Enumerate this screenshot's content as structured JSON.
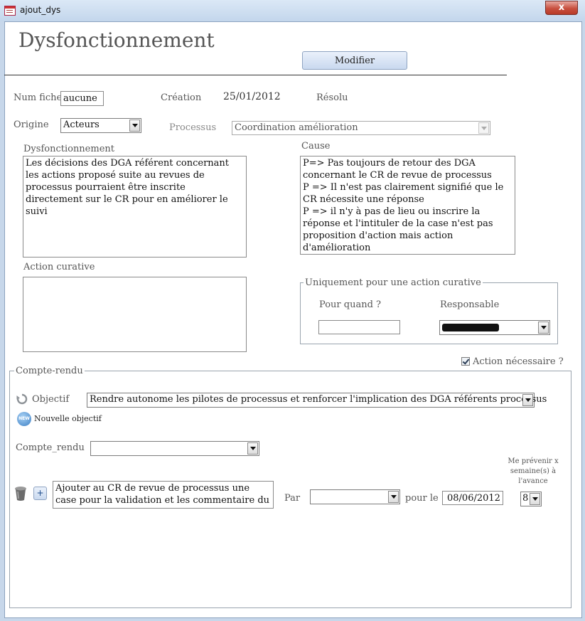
{
  "window": {
    "title": "ajout_dys",
    "close_label": "x"
  },
  "header": {
    "title": "Dysfonctionnement",
    "modify_button": "Modifier"
  },
  "fields": {
    "num_fiche": {
      "label": "Num fiche",
      "value": "aucune"
    },
    "creation": {
      "label": "Création",
      "value": "25/01/2012"
    },
    "resolu": {
      "label": "Résolu"
    },
    "origine": {
      "label": "Origine",
      "value": "Acteurs"
    },
    "processus": {
      "label": "Processus",
      "value": "Coordination amélioration"
    },
    "dysfonctionnement": {
      "label": "Dysfonctionnement",
      "value": "Les décisions des DGA référent concernant les actions proposé suite au revues de processus pourraient être inscrite directement sur le CR pour en améliorer le suivi"
    },
    "cause": {
      "label": "Cause",
      "value": "P=> Pas toujours de retour des DGA concernant le CR de revue de processus\nP => Il n'est pas clairement signifié que le CR nécessite une réponse\nP => il n'y à pas de lieu ou inscrire la réponse et l'intituler de la case n'est pas proposition d'action mais action d'amélioration\nP => Lors de la création des CR processus cela"
    },
    "action_curative": {
      "label": "Action curative",
      "value": ""
    }
  },
  "curative_group": {
    "legend": "Uniquement pour une action curative",
    "pour_quand": {
      "label": "Pour quand ?",
      "value": ""
    },
    "responsable": {
      "label": "Responsable",
      "value": ""
    }
  },
  "action_necessaire": {
    "label": "Action nécessaire ?",
    "checked": true
  },
  "compte_rendu_group": {
    "legend": "Compte-rendu",
    "objectif": {
      "label": "Objectif",
      "value": "Rendre autonome les pilotes de processus et renforcer l'implication des DGA référents processus"
    },
    "new_objectif": {
      "badge": "NEW",
      "label": "Nouvelle objectif"
    },
    "compte_rendu": {
      "label": "Compte_rendu",
      "value": ""
    },
    "action_text": "Ajouter au CR de revue de processus une case pour la validation et les commentaire du DGA sur",
    "add_label": "+",
    "par": {
      "label": "Par",
      "value": ""
    },
    "pour_le": {
      "label": "pour le",
      "value": "08/06/2012"
    },
    "prevenir": {
      "label": "Me prévenir x semaine(s) à l'avance",
      "value": "8"
    }
  }
}
